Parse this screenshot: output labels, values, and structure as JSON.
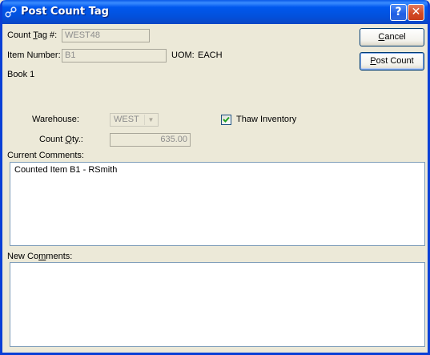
{
  "window": {
    "title": "Post Count Tag",
    "help_glyph": "?",
    "close_glyph": "✕"
  },
  "form": {
    "count_tag_label_pre": "Count ",
    "count_tag_label_key": "T",
    "count_tag_label_post": "ag #:",
    "count_tag_value": "WEST48",
    "item_number_label": "Item Number:",
    "item_number_value": "B1",
    "uom_label": "UOM:",
    "uom_value": "EACH",
    "description": "Book 1",
    "warehouse_label": "Warehouse:",
    "warehouse_value": "WEST",
    "count_qty_label_pre": "Count ",
    "count_qty_label_key": "Q",
    "count_qty_label_post": "ty.:",
    "count_qty_value": "635.00",
    "thaw_label": "Thaw Inventory",
    "thaw_checked": true,
    "current_comments_label": "Current Comments:",
    "current_comments_value": "Counted Item B1 - RSmith",
    "new_comments_label_pre": "New Co",
    "new_comments_label_key": "m",
    "new_comments_label_post": "ments:",
    "new_comments_value": ""
  },
  "buttons": {
    "cancel_key": "C",
    "cancel_rest": "ancel",
    "post_key": "P",
    "post_rest": "ost Count"
  },
  "colors": {
    "titlebar": "#0058ee",
    "dialog_bg": "#ece9d8",
    "check": "#21a121"
  },
  "icons": {
    "app": "app-link-icon",
    "help": "help-icon",
    "close": "close-icon",
    "check": "checkmark-icon",
    "dropdown": "chevron-down-icon"
  }
}
